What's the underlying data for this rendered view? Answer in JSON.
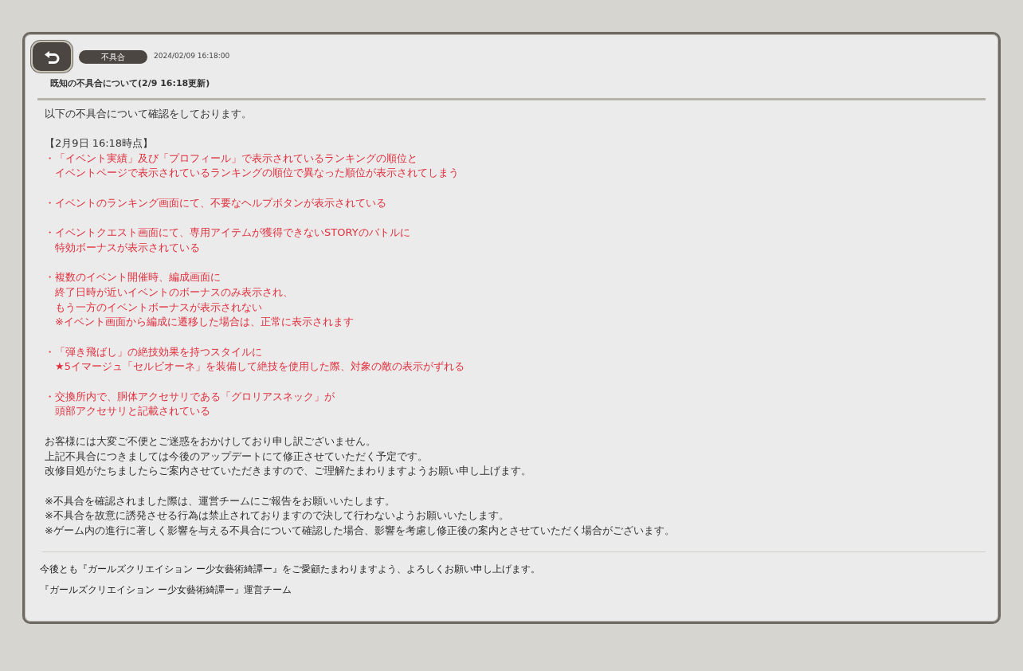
{
  "header": {
    "category": "不具合",
    "datetime": "2024/02/09 16:18:00",
    "title": "既知の不具合について(2/9 16:18更新)"
  },
  "body": [
    {
      "kind": "plain",
      "text": "以下の不具合について確認をしております。"
    },
    {
      "kind": "blank"
    },
    {
      "kind": "plain",
      "text": "【2月9日 16:18時点】"
    },
    {
      "kind": "alert",
      "text": "・「イベント実績」及び「プロフィール」で表示されているランキングの順位と"
    },
    {
      "kind": "alert-cont",
      "text": "イベントページで表示されているランキングの順位で異なった順位が表示されてしまう"
    },
    {
      "kind": "blank"
    },
    {
      "kind": "alert",
      "text": "・イベントのランキング画面にて、不要なヘルプボタンが表示されている"
    },
    {
      "kind": "blank"
    },
    {
      "kind": "alert",
      "text": "・イベントクエスト画面にて、専用アイテムが獲得できないSTORYのバトルに"
    },
    {
      "kind": "alert-cont",
      "text": "特効ボーナスが表示されている"
    },
    {
      "kind": "blank"
    },
    {
      "kind": "alert",
      "text": "・複数のイベント開催時、編成画面に"
    },
    {
      "kind": "alert-cont",
      "text": "終了日時が近いイベントのボーナスのみ表示され、"
    },
    {
      "kind": "alert-cont",
      "text": "もう一方のイベントボーナスが表示されない"
    },
    {
      "kind": "alert-cont",
      "text": "※イベント画面から編成に遷移した場合は、正常に表示されます"
    },
    {
      "kind": "blank"
    },
    {
      "kind": "alert",
      "text": "・「弾き飛ばし」の絶技効果を持つスタイルに"
    },
    {
      "kind": "alert-cont",
      "text": "★5イマージュ「セルビオーネ」を装備して絶技を使用した際、対象の敵の表示がずれる"
    },
    {
      "kind": "blank"
    },
    {
      "kind": "alert",
      "text": "・交換所内で、胴体アクセサリである「グロリアスネック」が"
    },
    {
      "kind": "alert-cont",
      "text": "頭部アクセサリと記載されている"
    },
    {
      "kind": "blank"
    },
    {
      "kind": "plain",
      "text": "お客様には大変ご不便とご迷惑をおかけしており申し訳ございません。"
    },
    {
      "kind": "plain",
      "text": "上記不具合につきましては今後のアップデートにて修正させていただく予定です。"
    },
    {
      "kind": "plain",
      "text": "改修目処がたちましたらご案内させていただきますので、ご理解たまわりますようお願い申し上げます。"
    },
    {
      "kind": "blank"
    },
    {
      "kind": "plain",
      "text": "※不具合を確認されました際は、運営チームにご報告をお願いいたします。"
    },
    {
      "kind": "plain",
      "text": "※不具合を故意に誘発させる行為は禁止されておりますので決して行わないようお願いいたします。"
    },
    {
      "kind": "plain",
      "text": "※ゲーム内の進行に著しく影響を与える不具合について確認した場合、影響を考慮し修正後の案内とさせていただく場合がございます。"
    }
  ],
  "footer": [
    "今後とも『ガールズクリエイション ー少女藝術綺譚ー』をご愛顧たまわりますよう、よろしくお願い申し上げます。",
    "『ガールズクリエイション ー少女藝術綺譚ー』運営チーム"
  ]
}
